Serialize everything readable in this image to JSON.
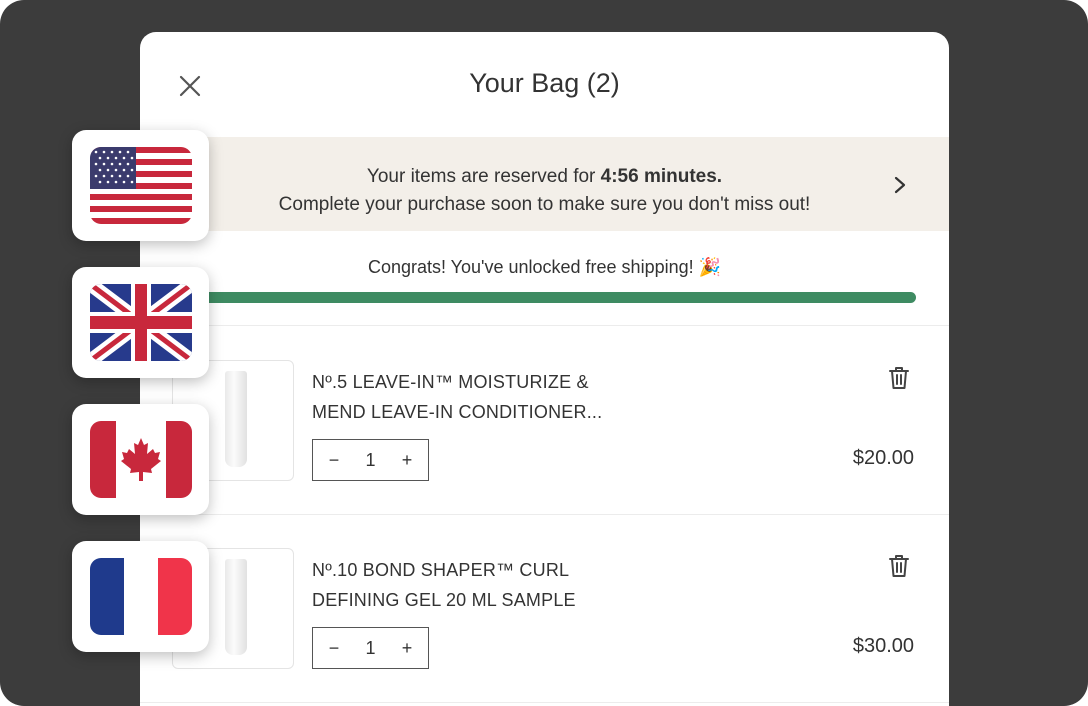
{
  "cart": {
    "title": "Your Bag (2)",
    "reservation": {
      "line1_prefix": "Your items are reserved for ",
      "time": "4:56 minutes.",
      "line2": "Complete your purchase soon to make sure you don't miss out!"
    },
    "shipping": {
      "message": "Congrats! You've unlocked free shipping! 🎉",
      "progress": 1.0
    },
    "items": [
      {
        "name_line1": "Nº.5 LEAVE-IN™ MOISTURIZE &",
        "name_line2": "MEND LEAVE-IN CONDITIONER...",
        "quantity": "1",
        "price": "$20.00"
      },
      {
        "name_line1": "Nº.10 BOND SHAPER™ CURL",
        "name_line2": "DEFINING GEL 20 ML SAMPLE",
        "quantity": "1",
        "price": "$30.00"
      }
    ],
    "qty_minus": "−",
    "qty_plus": "+"
  },
  "flags": [
    "us-flag",
    "uk-flag",
    "canada-flag",
    "france-flag"
  ],
  "colors": {
    "background": "#3c3c3c",
    "reservation_bg": "#f3efe9",
    "progress": "#3e8b62"
  }
}
